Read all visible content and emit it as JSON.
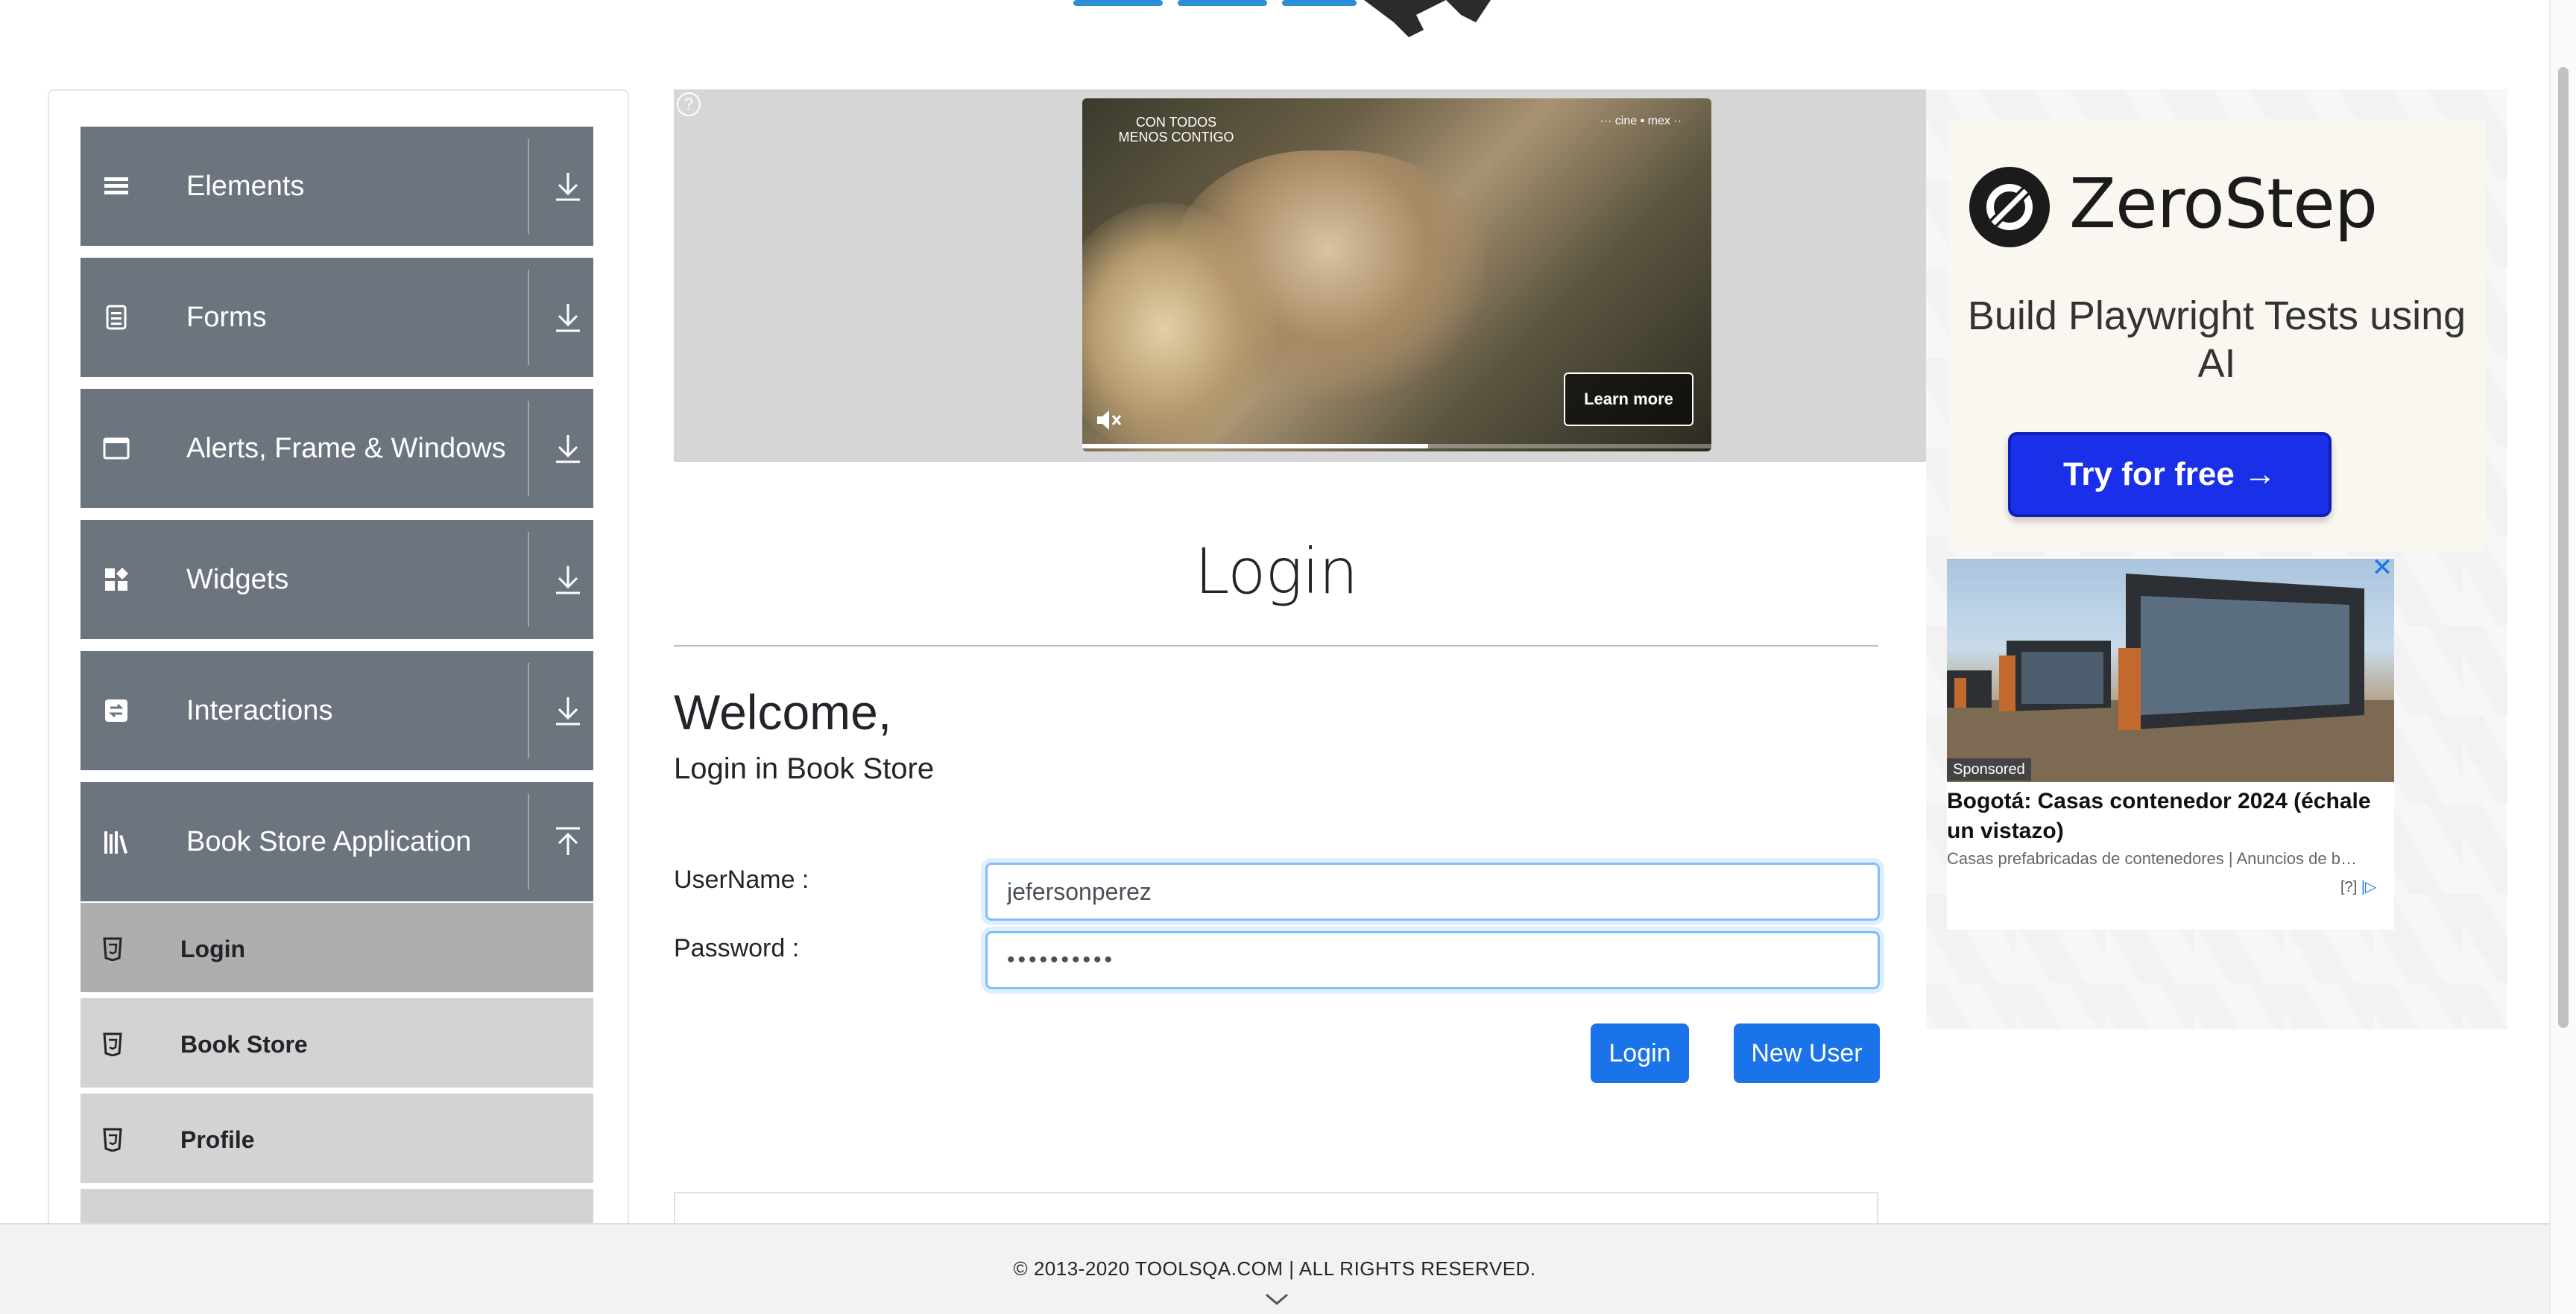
{
  "sidebar": {
    "groups": [
      {
        "label": "Elements",
        "icon": "list-icon"
      },
      {
        "label": "Forms",
        "icon": "form-icon"
      },
      {
        "label": "Alerts, Frame & Windows",
        "icon": "window-icon"
      },
      {
        "label": "Widgets",
        "icon": "widgets-icon"
      },
      {
        "label": "Interactions",
        "icon": "interactions-icon"
      },
      {
        "label": "Book Store Application",
        "icon": "books-icon"
      }
    ],
    "book_store_items": [
      {
        "label": "Login",
        "active": true
      },
      {
        "label": "Book Store",
        "active": false
      },
      {
        "label": "Profile",
        "active": false
      }
    ]
  },
  "video_ad": {
    "overlay_text": "CON TODOS MENOS CONTIGO",
    "brand": "··· cine ▪ mex ··",
    "cta": "Learn more",
    "progress": 0.55
  },
  "login": {
    "title": "Login",
    "welcome": "Welcome,",
    "subheading": "Login in Book Store",
    "username_label": "UserName :",
    "username_value": "jefersonperez",
    "password_label": "Password :",
    "password_value": "••••••••••",
    "login_button": "Login",
    "new_user_button": "New User"
  },
  "right_ad": {
    "brand": "ZeroStep",
    "tagline": "Build Playwright Tests using AI",
    "cta": "Try for free →",
    "native": {
      "badge": "Sponsored",
      "title": "Bogotá: Casas contenedor 2024 (échale un vistazo)",
      "description": "Casas prefabricadas de contenedores | Anuncios de b…",
      "adchoices": "[?]"
    }
  },
  "footer": {
    "text": "© 2013-2020 TOOLSQA.COM | ALL RIGHTS RESERVED."
  },
  "colors": {
    "sidebar_header": "#6c757d",
    "menu_item": "#d3d3d3",
    "menu_item_active": "#aeaeae",
    "primary_button": "#1a73e8",
    "cta_blue": "#1a2fe8",
    "logo_blue": "#2a8fd6"
  }
}
